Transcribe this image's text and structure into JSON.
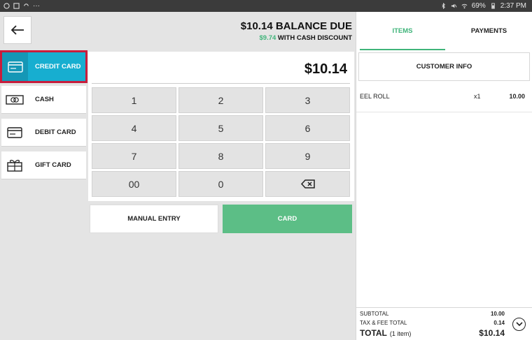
{
  "status_bar": {
    "battery": "69%",
    "time": "2:37 PM"
  },
  "header": {
    "balance_due": "$10.14 BALANCE DUE",
    "cash_discount_amount": "$9.74",
    "cash_discount_label": "WITH CASH DISCOUNT"
  },
  "payment_methods": [
    {
      "label": "CREDIT CARD",
      "icon": "credit-card-icon",
      "active": true
    },
    {
      "label": "CASH",
      "icon": "cash-icon",
      "active": false
    },
    {
      "label": "DEBIT CARD",
      "icon": "debit-card-icon",
      "active": false
    },
    {
      "label": "GIFT CARD",
      "icon": "gift-card-icon",
      "active": false
    }
  ],
  "keypad": {
    "amount": "$10.14",
    "keys": [
      "1",
      "2",
      "3",
      "4",
      "5",
      "6",
      "7",
      "8",
      "9",
      "00",
      "0"
    ],
    "backspace_icon": "backspace-icon"
  },
  "actions": {
    "manual_entry": "MANUAL ENTRY",
    "card": "CARD"
  },
  "colors": {
    "accent_green": "#5cbe86",
    "active_blue": "#17aed0",
    "highlight_red": "#c81c3c"
  },
  "right_panel": {
    "tabs": [
      "ITEMS",
      "PAYMENTS"
    ],
    "customer_info": "CUSTOMER INFO",
    "items": [
      {
        "name": "EEL ROLL",
        "qty": "x1",
        "price": "10.00"
      }
    ],
    "subtotal_label": "SUBTOTAL",
    "subtotal_value": "10.00",
    "tax_label": "TAX & FEE TOTAL",
    "tax_value": "0.14",
    "total_label": "TOTAL",
    "total_count": "(1 item)",
    "total_value": "$10.14"
  }
}
